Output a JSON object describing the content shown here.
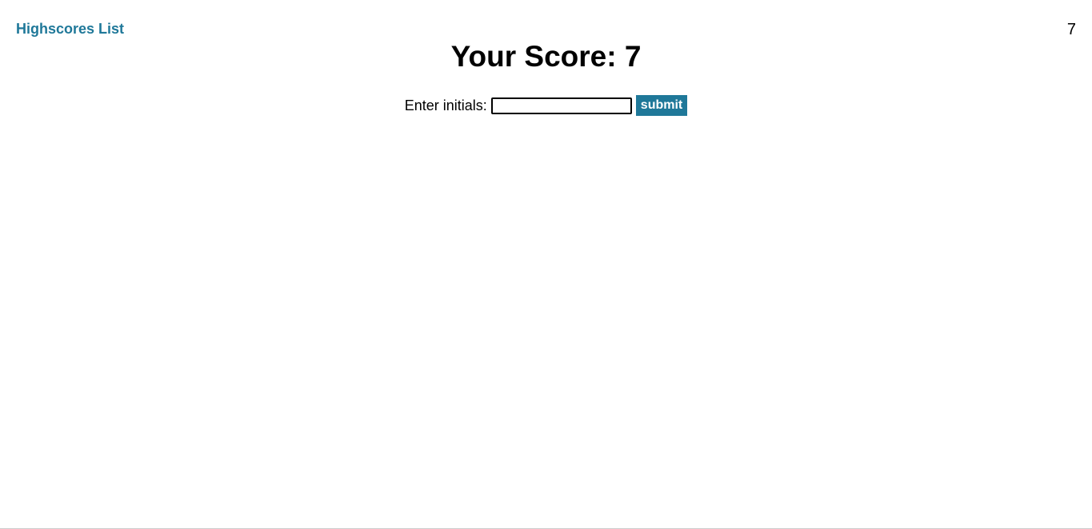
{
  "header": {
    "highscores_label": "Highscores List",
    "timer_value": "7"
  },
  "main": {
    "score_heading": "Your Score: 7",
    "form": {
      "label": "Enter initials:",
      "input_value": "",
      "submit_label": "submit"
    }
  },
  "colors": {
    "accent": "#1f7899"
  }
}
